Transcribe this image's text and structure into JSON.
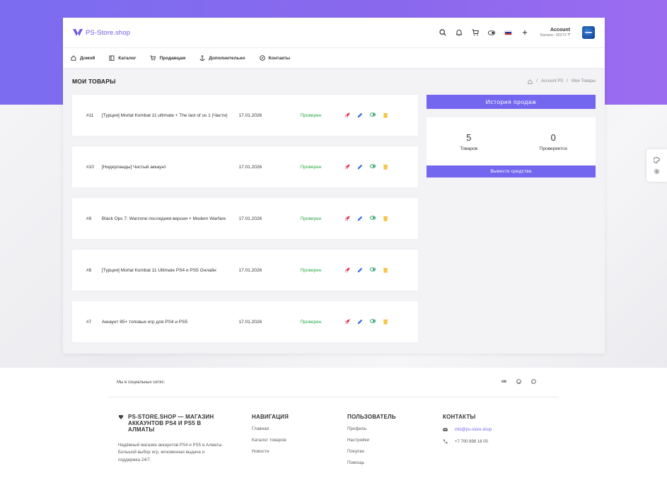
{
  "brand": {
    "name": "PS-Store.shop",
    "accent": "#7367f0"
  },
  "topbar": {
    "account_name": "Account",
    "account_balance": "Баланс: 30272 ₸"
  },
  "nav": {
    "items": [
      {
        "label": "Домой",
        "icon": "home-icon"
      },
      {
        "label": "Каталог",
        "icon": "book-icon"
      },
      {
        "label": "Продавцам",
        "icon": "cart-icon"
      },
      {
        "label": "Дополнительно",
        "icon": "anchor-icon"
      },
      {
        "label": "Контакты",
        "icon": "compass-icon"
      }
    ]
  },
  "page": {
    "title": "МОИ ТОВАРЫ",
    "breadcrumb": [
      "Account PS",
      "Мои Товары"
    ]
  },
  "products": [
    {
      "id": "#11",
      "title": "[Турция] Mortal Kombat 11 ultimate + The last of us 1 (Части)",
      "date": "17.01.2026",
      "status": "Проверен"
    },
    {
      "id": "#10",
      "title": "[Нидерланды] Чистый аккаунт",
      "date": "17.01.2026",
      "status": "Проверен"
    },
    {
      "id": "#9",
      "title": "Black Ops 7: Warzone последняя версия + Modern Warfare",
      "date": "17.01.2026",
      "status": "Проверен"
    },
    {
      "id": "#8",
      "title": "[Турция] Mortal Kombat 11 Ultimate PS4 и PS5 Онлайн",
      "date": "17.01.2026",
      "status": "Проверен"
    },
    {
      "id": "#7",
      "title": "Аккаунт 85+ топовых игр для PS4 и PS5",
      "date": "17.01.2026",
      "status": "Проверен"
    }
  ],
  "sidebar": {
    "history_button": "История продаж",
    "stats": [
      {
        "value": "5",
        "label": "Товаров"
      },
      {
        "value": "0",
        "label": "Проверяется"
      }
    ],
    "withdraw_button": "Вывести средства"
  },
  "footer": {
    "social_label": "Мы в социальных сетях:",
    "social": [
      "VK",
      "GitHub",
      "WhatsApp"
    ],
    "about_title": "PS-STORE.SHOP — МАГАЗИН АККАУНТОВ PS4 И PS5 В АЛМАТЫ",
    "about_text": "Надёжный магазин аккаунтов PS4 и PS5 в Алматы. Большой выбор игр, мгновенная выдача и поддержка 24/7.",
    "nav_title": "НАВИГАЦИЯ",
    "nav_links": [
      "Главная",
      "Каталог товаров",
      "Новости"
    ],
    "user_title": "ПОЛЬЗОВАТЕЛЬ",
    "user_links": [
      "Профиль",
      "Настройки",
      "Покупки",
      "Помощь"
    ],
    "contacts_title": "КОНТАКТЫ",
    "email": "info@ps-store.shop",
    "phone": "+7 700 898 16 00"
  }
}
